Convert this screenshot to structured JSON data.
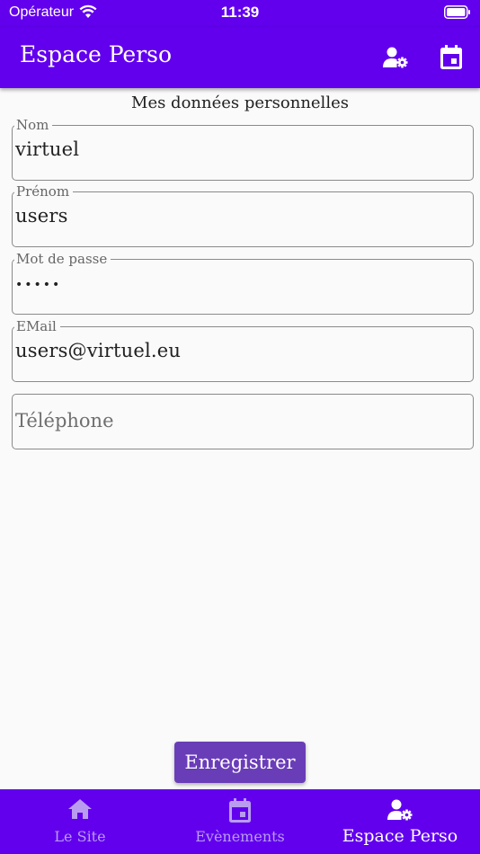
{
  "status_bar": {
    "carrier": "Opérateur",
    "time": "11:39"
  },
  "app_bar": {
    "title": "Espace Perso",
    "actions": [
      "person-settings-icon",
      "calendar-icon"
    ]
  },
  "form": {
    "section_title": "Mes données personnelles",
    "fields": [
      {
        "label": "Nom",
        "value": "virtuel"
      },
      {
        "label": "Prénom",
        "value": "users"
      },
      {
        "label": "Mot de passe",
        "value": "•••••"
      },
      {
        "label": "EMail",
        "value": "users@virtuel.eu"
      },
      {
        "label": "",
        "placeholder": "Téléphone",
        "value": ""
      }
    ],
    "save_label": "Enregistrer"
  },
  "bottom_nav": {
    "items": [
      {
        "label": "Le Site",
        "icon": "home-icon",
        "active": false
      },
      {
        "label": "Evènements",
        "icon": "calendar-icon",
        "active": false
      },
      {
        "label": "Espace Perso",
        "icon": "person-settings-icon",
        "active": true
      }
    ]
  },
  "colors": {
    "primary": "#6200ee",
    "button": "#6a3db8",
    "background": "#fafafa",
    "inactive_nav": "#b99cf0"
  }
}
